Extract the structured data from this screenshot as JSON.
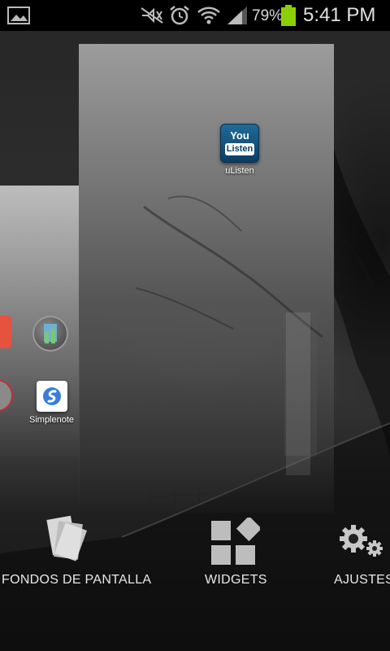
{
  "status_bar": {
    "battery_percent": "79%",
    "time": "5:41 PM",
    "icons": [
      "gallery-icon",
      "mute-icon",
      "alarm-icon",
      "wifi-icon",
      "signal-icon",
      "battery-icon"
    ]
  },
  "home_page": {
    "apps": [
      {
        "label": "uListen",
        "icon": "ulisten-icon",
        "icon_top_text": "You",
        "icon_bottom_text": "Listen"
      }
    ]
  },
  "side_page": {
    "apps": [
      {
        "label": "Simplenote",
        "icon": "simplenote-icon"
      },
      {
        "label": "",
        "icon": "cut-off-app-icon"
      },
      {
        "label": "",
        "icon": "round-app-icon"
      },
      {
        "label": "",
        "icon": "cut-off-app-icon"
      }
    ]
  },
  "options": [
    {
      "label": "FONDOS DE PANTALLA",
      "icon": "wallpapers-icon"
    },
    {
      "label": "WIDGETS",
      "icon": "widgets-icon"
    },
    {
      "label": "AJUSTES",
      "icon": "settings-icon"
    }
  ],
  "colors": {
    "battery": "#8ccf00",
    "status_bar_bg": "#000000"
  }
}
